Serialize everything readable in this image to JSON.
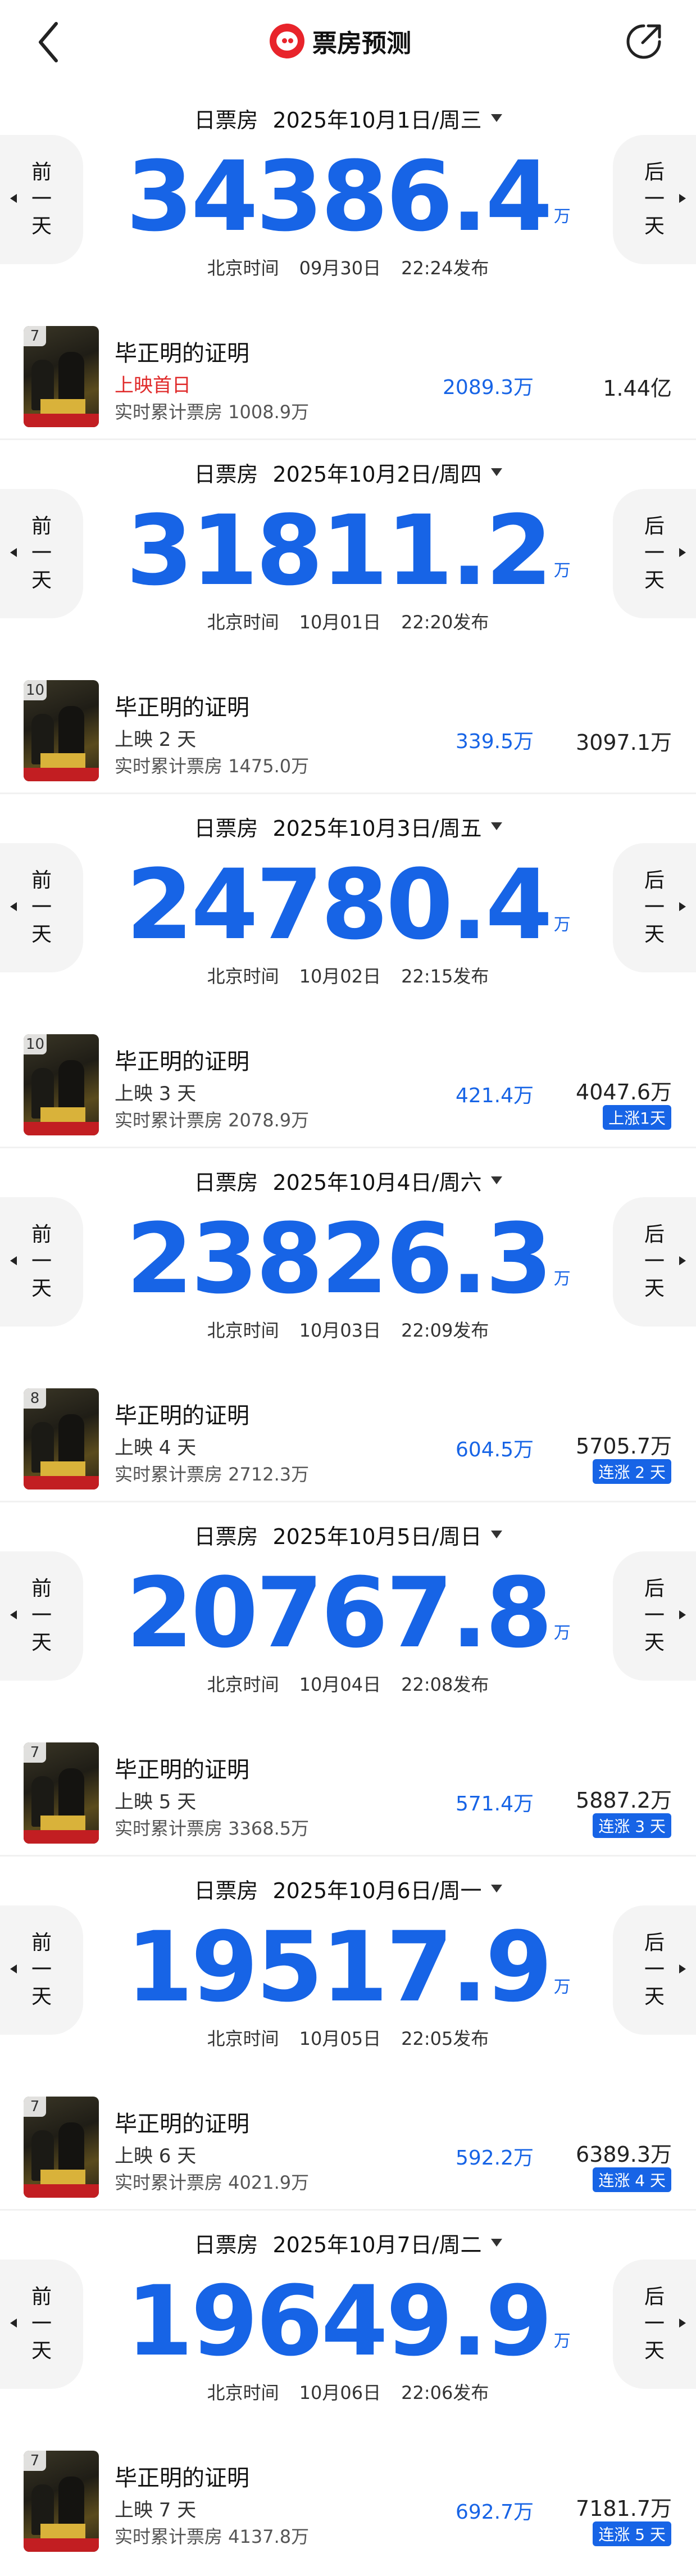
{
  "app": {
    "title": "票房预测"
  },
  "colors": {
    "accent": "#1764e6",
    "first_day": "#e02b2b",
    "logo": "#e8242b"
  },
  "nav": {
    "prev_lines": [
      "前",
      "一",
      "天"
    ],
    "next_lines": [
      "后",
      "一",
      "天"
    ]
  },
  "days": [
    {
      "label": "日票房",
      "date": "2025年10月1日/周三",
      "total": "34386.4",
      "unit": "万",
      "pub_label": "北京时间",
      "pub_date": "09月30日",
      "pub_time": "22:24发布",
      "film": {
        "rank": "7",
        "name": "毕正明的证明",
        "run": "上映首日",
        "cum": "实时累计票房 1008.9万",
        "day_box": "2089.3万",
        "total": "1.44亿",
        "badge": ""
      }
    },
    {
      "label": "日票房",
      "date": "2025年10月2日/周四",
      "total": "31811.2",
      "unit": "万",
      "pub_label": "北京时间",
      "pub_date": "10月01日",
      "pub_time": "22:20发布",
      "film": {
        "rank": "10",
        "name": "毕正明的证明",
        "run": "上映 2 天",
        "cum": "实时累计票房 1475.0万",
        "day_box": "339.5万",
        "total": "3097.1万",
        "badge": ""
      }
    },
    {
      "label": "日票房",
      "date": "2025年10月3日/周五",
      "total": "24780.4",
      "unit": "万",
      "pub_label": "北京时间",
      "pub_date": "10月02日",
      "pub_time": "22:15发布",
      "film": {
        "rank": "10",
        "name": "毕正明的证明",
        "run": "上映 3 天",
        "cum": "实时累计票房 2078.9万",
        "day_box": "421.4万",
        "total": "4047.6万",
        "badge": "上涨1天"
      }
    },
    {
      "label": "日票房",
      "date": "2025年10月4日/周六",
      "total": "23826.3",
      "unit": "万",
      "pub_label": "北京时间",
      "pub_date": "10月03日",
      "pub_time": "22:09发布",
      "film": {
        "rank": "8",
        "name": "毕正明的证明",
        "run": "上映 4 天",
        "cum": "实时累计票房 2712.3万",
        "day_box": "604.5万",
        "total": "5705.7万",
        "badge": "连涨 2 天"
      }
    },
    {
      "label": "日票房",
      "date": "2025年10月5日/周日",
      "total": "20767.8",
      "unit": "万",
      "pub_label": "北京时间",
      "pub_date": "10月04日",
      "pub_time": "22:08发布",
      "film": {
        "rank": "7",
        "name": "毕正明的证明",
        "run": "上映 5 天",
        "cum": "实时累计票房 3368.5万",
        "day_box": "571.4万",
        "total": "5887.2万",
        "badge": "连涨 3 天"
      }
    },
    {
      "label": "日票房",
      "date": "2025年10月6日/周一",
      "total": "19517.9",
      "unit": "万",
      "pub_label": "北京时间",
      "pub_date": "10月05日",
      "pub_time": "22:05发布",
      "film": {
        "rank": "7",
        "name": "毕正明的证明",
        "run": "上映 6 天",
        "cum": "实时累计票房 4021.9万",
        "day_box": "592.2万",
        "total": "6389.3万",
        "badge": "连涨 4 天"
      }
    },
    {
      "label": "日票房",
      "date": "2025年10月7日/周二",
      "total": "19649.9",
      "unit": "万",
      "pub_label": "北京时间",
      "pub_date": "10月06日",
      "pub_time": "22:06发布",
      "film": {
        "rank": "7",
        "name": "毕正明的证明",
        "run": "上映 7 天",
        "cum": "实时累计票房 4137.8万",
        "day_box": "692.7万",
        "total": "7181.7万",
        "badge": "连涨 5 天"
      }
    }
  ]
}
